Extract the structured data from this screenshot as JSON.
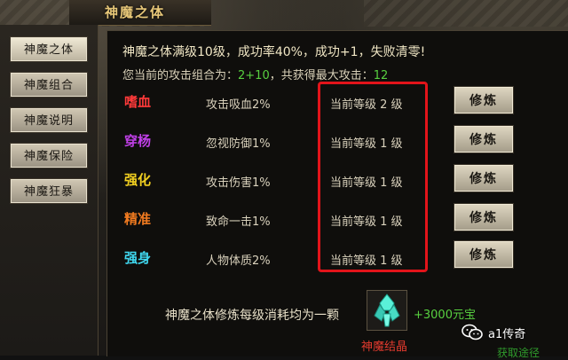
{
  "window": {
    "title": "神魔之体"
  },
  "sidebar": {
    "items": [
      {
        "label": "神魔之体",
        "active": true
      },
      {
        "label": "神魔组合",
        "active": false
      },
      {
        "label": "神魔说明",
        "active": false
      },
      {
        "label": "神魔保险",
        "active": false
      },
      {
        "label": "神魔狂暴",
        "active": false
      }
    ]
  },
  "main": {
    "headline": "神魔之体满级10级，成功率40%，成功+1，失败清零!",
    "combo_prefix": "您当前的攻击组合为：",
    "combo_value": "2+10",
    "combo_mid": "，共获得最大攻击：",
    "max_attack": "12",
    "rows": [
      {
        "name": "嗜血",
        "name_color": "#ff3a3a",
        "effect": "攻击吸血2%",
        "level": "当前等级 2 级",
        "button": "修炼"
      },
      {
        "name": "穿杨",
        "name_color": "#c040e8",
        "effect": "忽视防御1%",
        "level": "当前等级 1 级",
        "button": "修炼"
      },
      {
        "name": "强化",
        "name_color": "#f2d020",
        "effect": "攻击伤害1%",
        "level": "当前等级 1 级",
        "button": "修炼"
      },
      {
        "name": "精准",
        "name_color": "#f07a20",
        "effect": "致命一击1%",
        "level": "当前等级 1 级",
        "button": "修炼"
      },
      {
        "name": "强身",
        "name_color": "#40d8f0",
        "effect": "人物体质2%",
        "level": "当前等级 1 级",
        "button": "修炼"
      }
    ],
    "cost_text": "神魔之体修炼每级消耗均为一颗",
    "item_name": "神魔结晶",
    "item_icon": "crystal-icon",
    "reward_text": "+3000元宝",
    "reward_extra": "获取途径"
  },
  "watermark": {
    "text": "a1传奇",
    "icon": "wechat-icon"
  },
  "colors": {
    "highlight": "#e2141a",
    "accent_green": "#58d040",
    "title_gold": "#e8c879"
  }
}
